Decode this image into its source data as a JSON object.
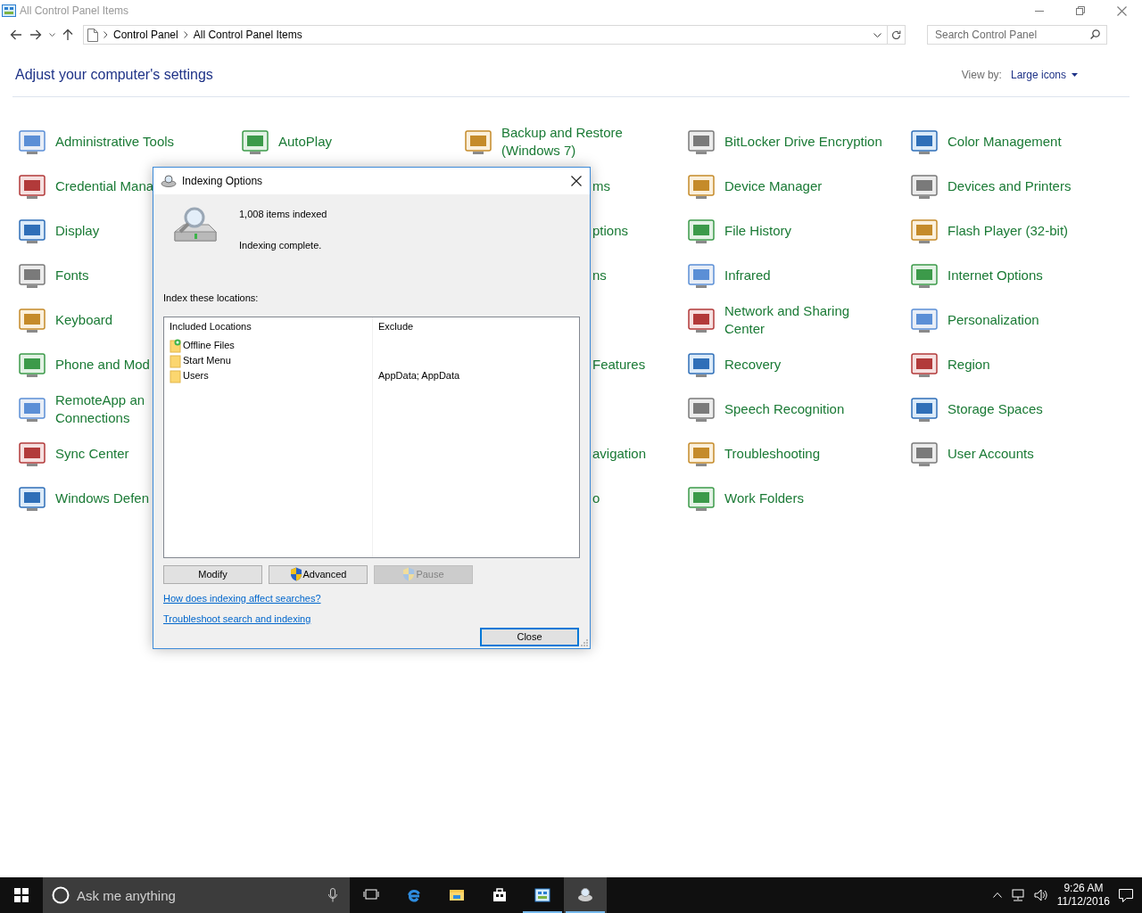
{
  "window": {
    "title": "All Control Panel Items"
  },
  "address": {
    "breadcrumb": [
      "Control Panel",
      "All Control Panel Items"
    ],
    "search_placeholder": "Search Control Panel"
  },
  "heading": "Adjust your computer's settings",
  "view_by": {
    "label": "View by:",
    "value": "Large icons"
  },
  "items": [
    {
      "kind": "full",
      "label": "Administrative Tools"
    },
    {
      "kind": "full",
      "label": "AutoPlay"
    },
    {
      "kind": "full",
      "label": "Backup and Restore\n(Windows 7)"
    },
    {
      "kind": "full",
      "label": "BitLocker Drive Encryption"
    },
    {
      "kind": "full",
      "label": "Color Management"
    },
    {
      "kind": "cut_right",
      "label": "Credential Mana"
    },
    {
      "kind": "covered"
    },
    {
      "kind": "cut_left",
      "label": "ms"
    },
    {
      "kind": "full",
      "label": "Device Manager"
    },
    {
      "kind": "full",
      "label": "Devices and Printers"
    },
    {
      "kind": "full",
      "label": "Display"
    },
    {
      "kind": "covered"
    },
    {
      "kind": "cut_left",
      "label": "ptions"
    },
    {
      "kind": "full",
      "label": "File History"
    },
    {
      "kind": "full",
      "label": "Flash Player (32-bit)"
    },
    {
      "kind": "full",
      "label": "Fonts"
    },
    {
      "kind": "covered"
    },
    {
      "kind": "cut_left",
      "label": "ns"
    },
    {
      "kind": "full",
      "label": "Infrared"
    },
    {
      "kind": "full",
      "label": "Internet Options"
    },
    {
      "kind": "full",
      "label": "Keyboard"
    },
    {
      "kind": "covered"
    },
    {
      "kind": "covered"
    },
    {
      "kind": "full",
      "label": "Network and Sharing\nCenter"
    },
    {
      "kind": "full",
      "label": "Personalization"
    },
    {
      "kind": "cut_right",
      "label": "Phone and Mod"
    },
    {
      "kind": "covered"
    },
    {
      "kind": "cut_left",
      "label": "Features"
    },
    {
      "kind": "full",
      "label": "Recovery"
    },
    {
      "kind": "full",
      "label": "Region"
    },
    {
      "kind": "cut_right",
      "label": "RemoteApp an\nConnections"
    },
    {
      "kind": "covered"
    },
    {
      "kind": "covered"
    },
    {
      "kind": "full",
      "label": "Speech Recognition"
    },
    {
      "kind": "full",
      "label": "Storage Spaces"
    },
    {
      "kind": "full",
      "label": "Sync Center"
    },
    {
      "kind": "covered"
    },
    {
      "kind": "cut_left",
      "label": "avigation"
    },
    {
      "kind": "full",
      "label": "Troubleshooting"
    },
    {
      "kind": "full",
      "label": "User Accounts"
    },
    {
      "kind": "cut_right",
      "label": "Windows Defen"
    },
    {
      "kind": "covered"
    },
    {
      "kind": "cut_left",
      "label": "o"
    },
    {
      "kind": "full",
      "label": "Work Folders"
    }
  ],
  "dialog": {
    "title": "Indexing Options",
    "count": "1,008 items indexed",
    "status": "Indexing complete.",
    "locations_label": "Index these locations:",
    "columns": [
      "Included Locations",
      "Exclude"
    ],
    "rows": [
      {
        "kind": "offline",
        "location": "Offline Files",
        "exclude": ""
      },
      {
        "kind": "folder",
        "location": "Start Menu",
        "exclude": ""
      },
      {
        "kind": "folder",
        "location": "Users",
        "exclude": "AppData; AppData"
      }
    ],
    "buttons": [
      {
        "label": "Modify",
        "shield": false,
        "disabled": false
      },
      {
        "label": "Advanced",
        "shield": true,
        "disabled": false
      },
      {
        "label": "Pause",
        "shield": true,
        "disabled": true
      }
    ],
    "links": [
      "How does indexing affect searches?",
      "Troubleshoot search and indexing"
    ],
    "close_label": "Close"
  },
  "taskbar": {
    "search_placeholder": "Ask me anything",
    "apps": [
      {
        "open": false,
        "selected": false
      },
      {
        "open": false,
        "selected": false
      },
      {
        "open": false,
        "selected": false
      },
      {
        "open": false,
        "selected": false
      },
      {
        "open": true,
        "selected": false
      },
      {
        "open": true,
        "selected": true
      }
    ],
    "time": "9:26 AM",
    "date": "11/12/2016"
  }
}
